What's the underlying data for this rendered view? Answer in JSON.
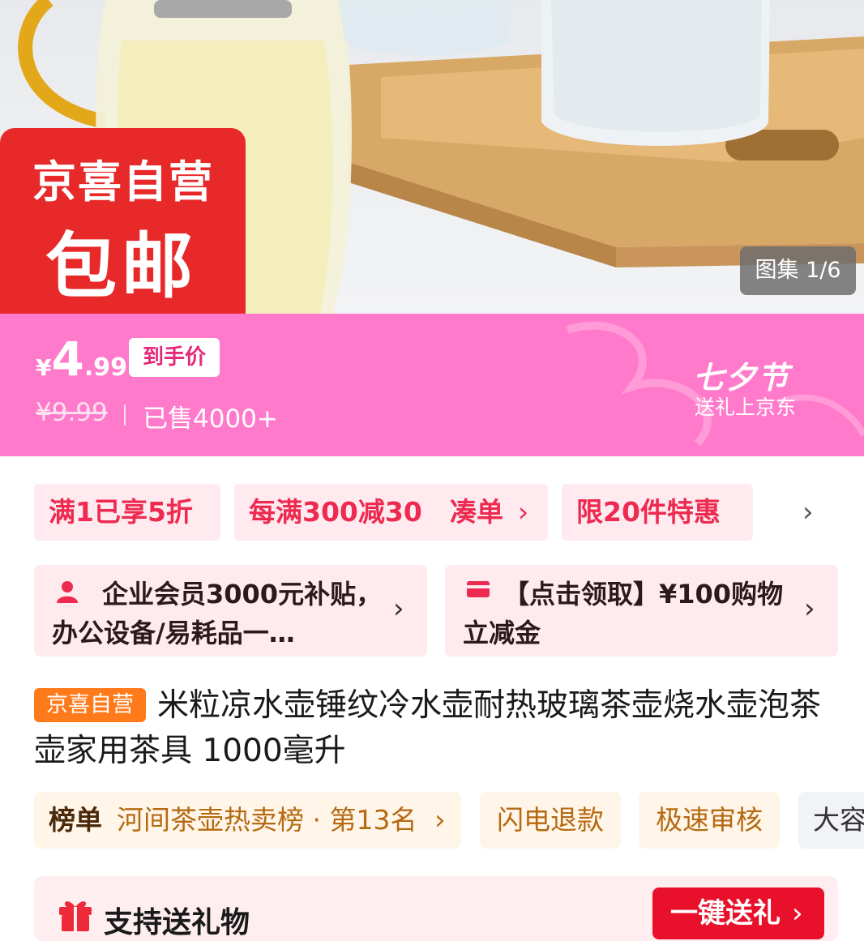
{
  "gallery": {
    "badge_line1": "京喜自营",
    "badge_line2": "包邮",
    "counter_label": "图集",
    "counter_index": "1/6"
  },
  "price": {
    "currency": "¥",
    "integer": "4",
    "decimal": ".99",
    "final_tag": "到手价",
    "original": "¥9.99",
    "sold": "已售4000+"
  },
  "festival": {
    "title": "七夕节",
    "subtitle": "送礼上京东"
  },
  "promos": [
    {
      "label": "满1已享5折"
    },
    {
      "label": "每满300减30",
      "action": "凑单"
    },
    {
      "label": "限20件特惠"
    }
  ],
  "coupons": [
    {
      "text": "企业会员3000元补贴，办公设备/易耗品一…",
      "icon": "person-icon"
    },
    {
      "text": "【点击领取】¥100购物立减金",
      "icon": "card-icon"
    }
  ],
  "product": {
    "store_badge": "京喜自营",
    "title": "米粒凉水壶锤纹冷水壶耐热玻璃茶壶烧水壶泡茶壶家用茶具 1000毫升"
  },
  "ranking": {
    "label": "榜单",
    "value": "河间茶壶热卖榜 · 第13名"
  },
  "tags": [
    "闪电退款",
    "极速审核",
    "大容"
  ],
  "gift": {
    "label": "支持送礼物",
    "button": "一键送礼"
  },
  "colors": {
    "price_banner": "#ff7acb",
    "badge_red": "#e8292a",
    "promo_text": "#ee2a50",
    "self_badge": "#ff7a1a",
    "gift_button": "#e8102b"
  }
}
